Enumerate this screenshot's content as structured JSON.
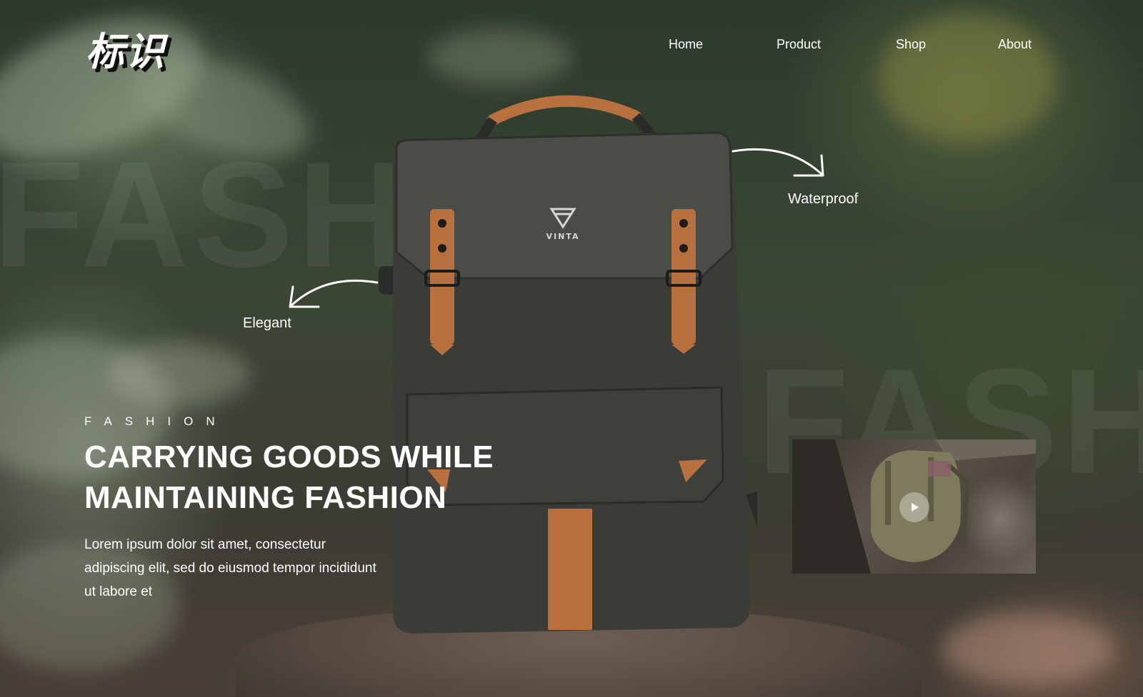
{
  "logo": {
    "text": "标识"
  },
  "nav": {
    "items": [
      {
        "label": "Home"
      },
      {
        "label": "Product"
      },
      {
        "label": "Shop"
      },
      {
        "label": "About"
      }
    ]
  },
  "background": {
    "ghost_text_1": "FASHION",
    "ghost_text_2": "FASHION"
  },
  "product": {
    "brand_mark": "VINTA"
  },
  "callouts": {
    "waterproof": "Waterproof",
    "elegant": "Elegant"
  },
  "hero": {
    "eyebrow": "FASHION",
    "headline_line1": "CARRYING GOODS WHILE",
    "headline_line2": "MAINTAINING FASHION",
    "body": "Lorem ipsum dolor sit amet, consectetur adipiscing elit, sed do eiusmod tempor incididunt ut labore et"
  },
  "video": {
    "play_icon": "play-icon"
  },
  "colors": {
    "accent_leather": "#b8703f",
    "text": "#ffffff",
    "bag_body": "#3b3d39"
  }
}
